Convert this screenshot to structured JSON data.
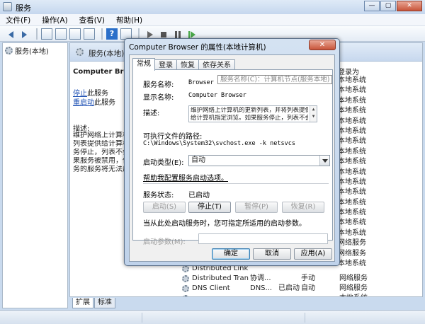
{
  "window": {
    "title": "服务",
    "controls": [
      "—",
      "▢",
      "✕"
    ]
  },
  "menu": [
    "文件(F)",
    "操作(A)",
    "查看(V)",
    "帮助(H)"
  ],
  "tree": {
    "item": "服务(本地)"
  },
  "content": {
    "header": "服务(本地)",
    "service_name": "Computer Browser",
    "links": {
      "stop": "停止",
      "stop_suffix": "此服务",
      "restart": "重启动",
      "restart_suffix": "此服务"
    },
    "desc_label": "描述:",
    "desc_lines": [
      "维护网络上计算机的",
      "列表提供给计算机",
      "务停止，列表不会",
      "果服务被禁用，任",
      "务的服务将无法启"
    ],
    "col_header": "登录为",
    "startup_list": [
      "本地系统",
      "本地系统",
      "本地系统",
      "本地系统",
      "本地系统",
      "本地系统",
      "本地系统",
      "本地系统",
      "本地系统",
      "本地系统",
      "本地系统",
      "本地系统",
      "本地系统",
      "本地系统",
      "本地系统",
      "本地系统",
      "网络服务",
      "网络服务",
      "本地系统"
    ],
    "rows": [
      {
        "name": "Distributed Link...",
        "desc": "",
        "status": "",
        "type": "",
        "logon": ""
      },
      {
        "name": "Distributed Tran...",
        "desc": "协调...",
        "status": "",
        "type": "手动",
        "logon": "网络服务"
      },
      {
        "name": "DNS Client",
        "desc": "DNS...",
        "status": "已启动",
        "type": "自动",
        "logon": "网络服务"
      },
      {
        "name": "",
        "desc": "",
        "status": "",
        "type": "",
        "logon": "本地系统"
      }
    ],
    "bottom_tabs": [
      "扩展",
      "标准"
    ]
  },
  "dialog": {
    "title": "Computer Browser 的属性(本地计算机)",
    "close": "✕",
    "tabs": [
      "常规",
      "登录",
      "恢复",
      "依存关系"
    ],
    "tooltip": "服务名称(C)：计算机节点(服务本地)",
    "fields": {
      "service_name_label": "服务名称:",
      "service_name": "Browser",
      "display_name_label": "显示名称:",
      "display_name": "Computer Browser",
      "desc_label": "描述:",
      "desc_lines": [
        "维护网络上计算机的更新列表，并将列表提供",
        "给计算机指定浏览。如果服务停止，列表不会"
      ],
      "exe_label": "可执行文件的路径:",
      "exe_path": "C:\\Windows\\System32\\svchost.exe -k netsvcs",
      "startup_label": "启动类型(E):",
      "startup_value": "自动",
      "help_link": "帮助我配置服务启动选项。",
      "status_label": "服务状态:",
      "status_value": "已启动",
      "params_note": "当从此处启动服务时，您可指定所适用的启动参数。",
      "params_label": "启动参数(M):"
    },
    "buttons": {
      "start": "启动(S)",
      "stop": "停止(T)",
      "pause": "暂停(P)",
      "resume": "恢复(R)",
      "ok": "确定",
      "cancel": "取消",
      "apply": "应用(A)"
    }
  }
}
